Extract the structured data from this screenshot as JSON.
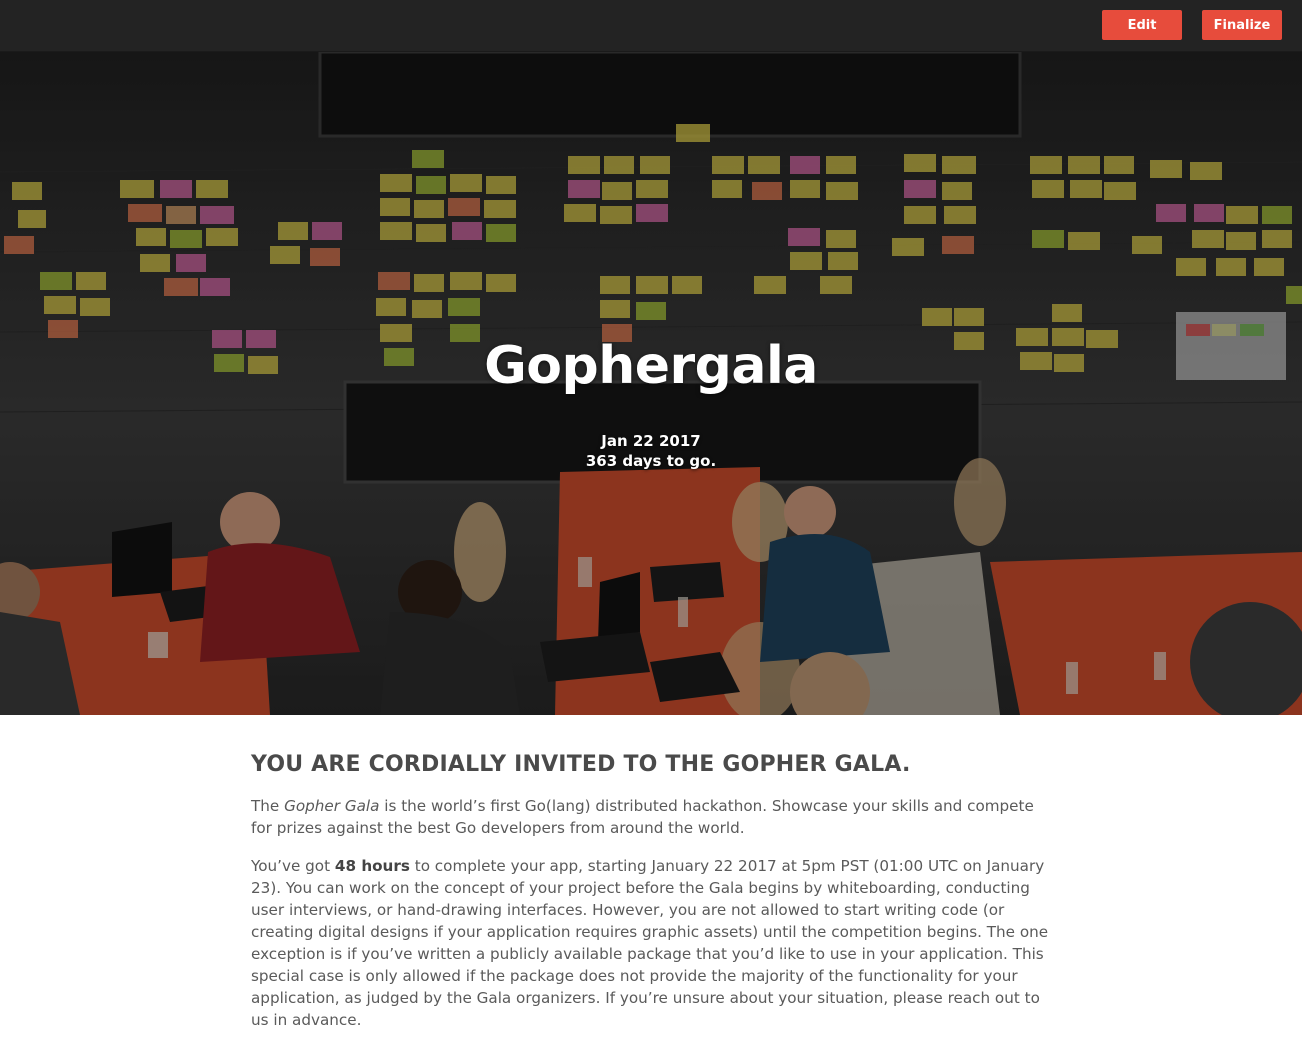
{
  "toolbar": {
    "edit_label": "Edit",
    "finalize_label": "Finalize"
  },
  "hero": {
    "title": "Gophergala",
    "date": "Jan 22 2017",
    "countdown": "363 days to go."
  },
  "content": {
    "heading": "YOU ARE CORDIALLY INVITED TO THE GOPHER GALA.",
    "p1": {
      "before": "The ",
      "emphasis": "Gopher Gala",
      "after": " is the world’s first Go(lang) distributed hackathon. Showcase your skills and compete for prizes against the best Go developers from around the world."
    },
    "p2": {
      "before": "You’ve got ",
      "strong": "48 hours",
      "after": " to complete your app, starting January 22 2017 at 5pm PST (01:00 UTC on January 23). You can work on the concept of your project before the Gala begins by whiteboarding, conducting user interviews, or hand-drawing interfaces. However, you are not allowed to start writing code (or creating digital designs if your application requires graphic assets) until the competition begins. The one exception is if you’ve written a publicly available package that you’d like to use in your application. This special case is only allowed if the package does not provide the majority of the functionality for your application, as judged by the Gala organizers. If you’re unsure about your situation, please reach out to us in advance."
    }
  },
  "colors": {
    "accent": "#e74c3c",
    "topbar": "#232323"
  }
}
